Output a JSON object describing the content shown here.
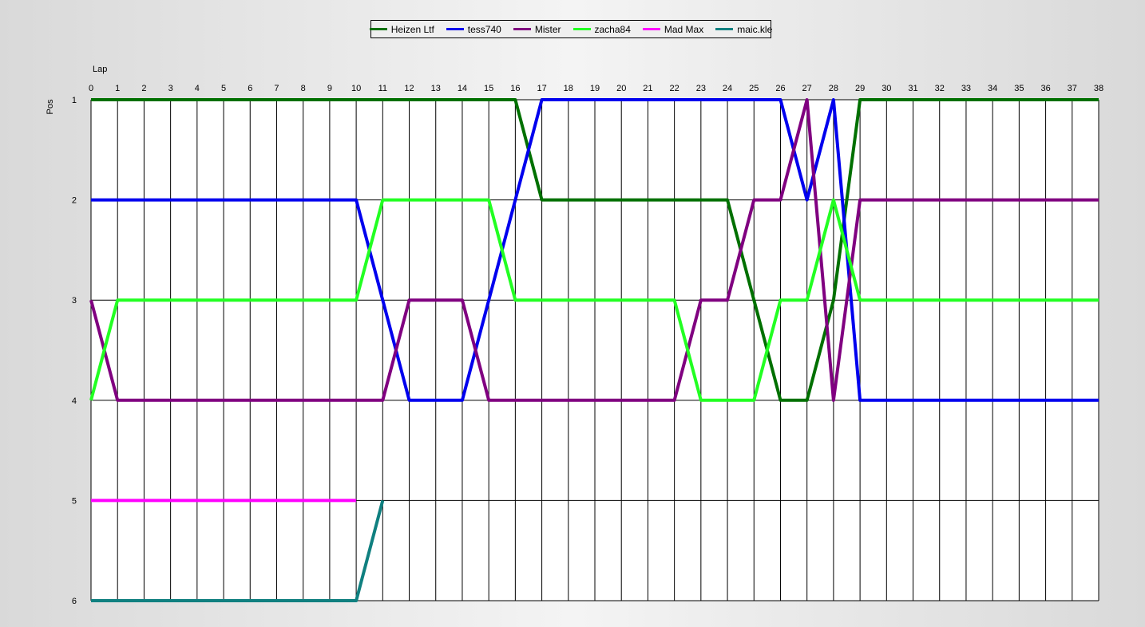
{
  "chart_data": {
    "type": "line",
    "xlabel": "Lap",
    "ylabel": "Pos",
    "x_ticks": [
      0,
      1,
      2,
      3,
      4,
      5,
      6,
      7,
      8,
      9,
      10,
      11,
      12,
      13,
      14,
      15,
      16,
      17,
      18,
      19,
      20,
      21,
      22,
      23,
      24,
      25,
      26,
      27,
      28,
      29,
      30,
      31,
      32,
      33,
      34,
      35,
      36,
      37,
      38
    ],
    "y_ticks": [
      1,
      2,
      3,
      4,
      5,
      6
    ],
    "xlim": [
      0,
      38
    ],
    "ylim": [
      1,
      6
    ],
    "y_inverted": true,
    "grid": true,
    "legend_position": "top-center",
    "series": [
      {
        "name": "Heizen Ltf",
        "color": "#007000",
        "x": [
          0,
          1,
          2,
          3,
          4,
          5,
          6,
          7,
          8,
          9,
          10,
          11,
          12,
          13,
          14,
          15,
          16,
          17,
          18,
          19,
          20,
          21,
          22,
          23,
          24,
          25,
          26,
          27,
          28,
          29,
          30,
          31,
          32,
          33,
          34,
          35,
          36,
          37,
          38
        ],
        "values": [
          1,
          1,
          1,
          1,
          1,
          1,
          1,
          1,
          1,
          1,
          1,
          1,
          1,
          1,
          1,
          1,
          1,
          2,
          2,
          2,
          2,
          2,
          2,
          2,
          2,
          3,
          4,
          4,
          3,
          1,
          1,
          1,
          1,
          1,
          1,
          1,
          1,
          1,
          1
        ]
      },
      {
        "name": "tess740",
        "color": "#0000ee",
        "x": [
          0,
          1,
          2,
          3,
          4,
          5,
          6,
          7,
          8,
          9,
          10,
          11,
          12,
          13,
          14,
          15,
          16,
          17,
          18,
          19,
          20,
          21,
          22,
          23,
          24,
          25,
          26,
          27,
          28,
          29,
          30,
          31,
          32,
          33,
          34,
          35,
          36,
          37,
          38
        ],
        "values": [
          2,
          2,
          2,
          2,
          2,
          2,
          2,
          2,
          2,
          2,
          2,
          3,
          4,
          4,
          4,
          3,
          2,
          1,
          1,
          1,
          1,
          1,
          1,
          1,
          1,
          1,
          1,
          2,
          1,
          4,
          4,
          4,
          4,
          4,
          4,
          4,
          4,
          4,
          4
        ]
      },
      {
        "name": "Mister",
        "color": "#800080",
        "x": [
          0,
          1,
          2,
          3,
          4,
          5,
          6,
          7,
          8,
          9,
          10,
          11,
          12,
          13,
          14,
          15,
          16,
          17,
          18,
          19,
          20,
          21,
          22,
          23,
          24,
          25,
          26,
          27,
          28,
          29,
          30,
          31,
          32,
          33,
          34,
          35,
          36,
          37,
          38
        ],
        "values": [
          3,
          4,
          4,
          4,
          4,
          4,
          4,
          4,
          4,
          4,
          4,
          4,
          3,
          3,
          3,
          4,
          4,
          4,
          4,
          4,
          4,
          4,
          4,
          3,
          3,
          2,
          2,
          1,
          4,
          2,
          2,
          2,
          2,
          2,
          2,
          2,
          2,
          2,
          2
        ]
      },
      {
        "name": "zacha84",
        "color": "#22ff22",
        "x": [
          0,
          1,
          2,
          3,
          4,
          5,
          6,
          7,
          8,
          9,
          10,
          11,
          12,
          13,
          14,
          15,
          16,
          17,
          18,
          19,
          20,
          21,
          22,
          23,
          24,
          25,
          26,
          27,
          28,
          29,
          30,
          31,
          32,
          33,
          34,
          35,
          36,
          37,
          38
        ],
        "values": [
          4,
          3,
          3,
          3,
          3,
          3,
          3,
          3,
          3,
          3,
          3,
          2,
          2,
          2,
          2,
          2,
          3,
          3,
          3,
          3,
          3,
          3,
          3,
          4,
          4,
          4,
          3,
          3,
          2,
          3,
          3,
          3,
          3,
          3,
          3,
          3,
          3,
          3,
          3
        ]
      },
      {
        "name": "Mad Max",
        "color": "#ff00ff",
        "x": [
          0,
          1,
          2,
          3,
          4,
          5,
          6,
          7,
          8,
          9,
          10
        ],
        "values": [
          5,
          5,
          5,
          5,
          5,
          5,
          5,
          5,
          5,
          5,
          5
        ]
      },
      {
        "name": "maic.kle",
        "color": "#108080",
        "x": [
          0,
          1,
          2,
          3,
          4,
          5,
          6,
          7,
          8,
          9,
          10,
          11
        ],
        "values": [
          6,
          6,
          6,
          6,
          6,
          6,
          6,
          6,
          6,
          6,
          6,
          5
        ]
      }
    ]
  }
}
